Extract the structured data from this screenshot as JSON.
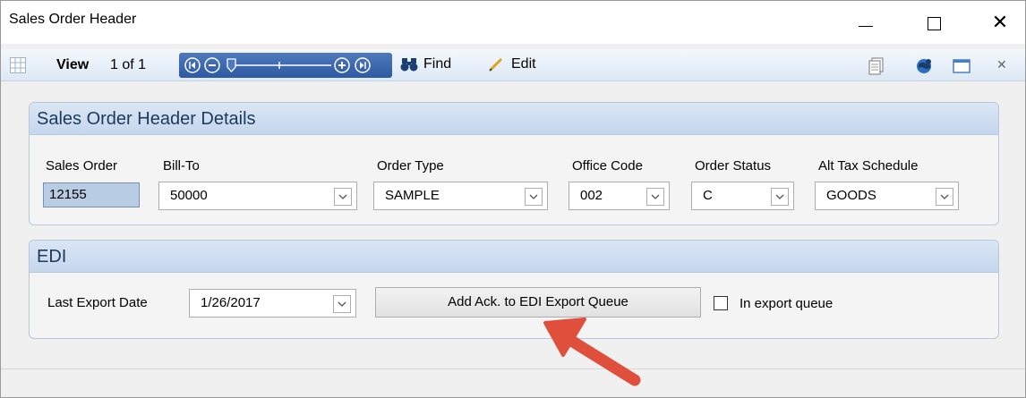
{
  "window": {
    "title": "Sales Order Header",
    "minimize_icon": "minimize-icon",
    "maximize_icon": "maximize-icon",
    "close_icon": "close-icon"
  },
  "toolbar": {
    "view_label": "View",
    "page_indicator": "1 of 1",
    "find_label": "Find",
    "edit_label": "Edit",
    "nav_strip_color": "#3a64ad"
  },
  "details": {
    "header": "Sales Order Header Details",
    "fields": {
      "sales_order": {
        "label": "Sales Order",
        "value": "12155"
      },
      "bill_to": {
        "label": "Bill-To",
        "value": "50000"
      },
      "order_type": {
        "label": "Order Type",
        "value": "SAMPLE"
      },
      "office_code": {
        "label": "Office Code",
        "value": "002"
      },
      "order_status": {
        "label": "Order Status",
        "value": "C"
      },
      "alt_tax_schedule": {
        "label": "Alt Tax Schedule",
        "value": "GOODS"
      }
    }
  },
  "edi": {
    "header": "EDI",
    "last_export_date_label": "Last Export Date",
    "last_export_date_value": "1/26/2017",
    "add_ack_button": "Add Ack. to EDI Export Queue",
    "in_export_queue_label": "In export queue",
    "in_export_queue_checked": false
  },
  "colors": {
    "group_header": "#c5d7ee",
    "group_header_text": "#1e395b",
    "readonly_field": "#b8cce4",
    "annotation_arrow": "#e04f3c"
  }
}
